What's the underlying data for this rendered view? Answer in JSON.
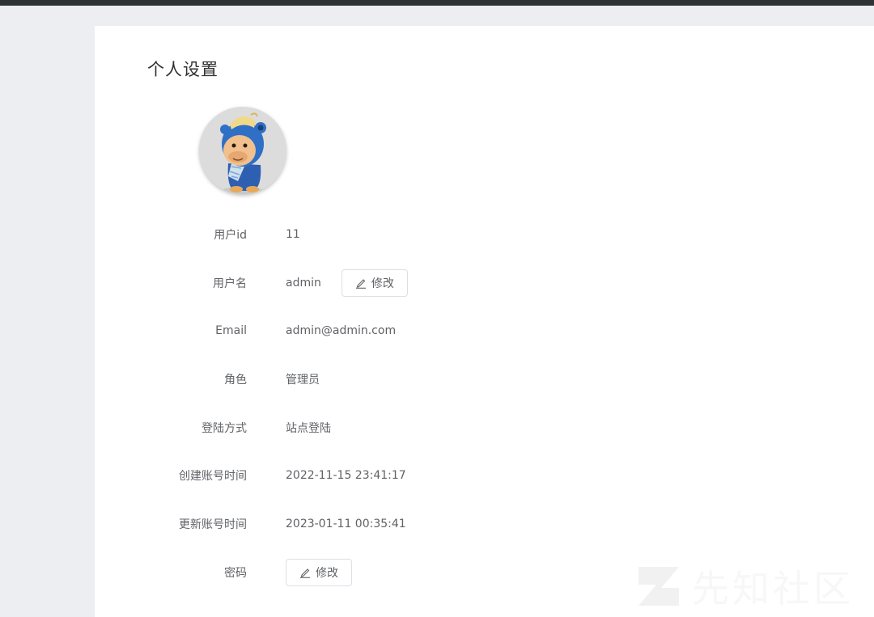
{
  "page": {
    "title": "个人设置"
  },
  "profile": {
    "fields": [
      {
        "label": "用户id",
        "value": "11"
      },
      {
        "label": "用户名",
        "value": "admin"
      },
      {
        "label": "Email",
        "value": "admin@admin.com"
      },
      {
        "label": "角色",
        "value": "管理员"
      },
      {
        "label": "登陆方式",
        "value": "站点登陆"
      },
      {
        "label": "创建账号时间",
        "value": "2022-11-15 23:41:17"
      },
      {
        "label": "更新账号时间",
        "value": "2023-01-11 00:35:41"
      },
      {
        "label": "密码",
        "value": ""
      }
    ],
    "edit_username_label": "修改",
    "edit_password_label": "修改"
  },
  "watermark": {
    "text": "先知社区"
  },
  "icons": {
    "edit": "pencil-icon"
  },
  "colors": {
    "background": "#eceef1",
    "card": "#ffffff",
    "text": "#606266",
    "title": "#303133",
    "border": "#dcdfe6"
  }
}
